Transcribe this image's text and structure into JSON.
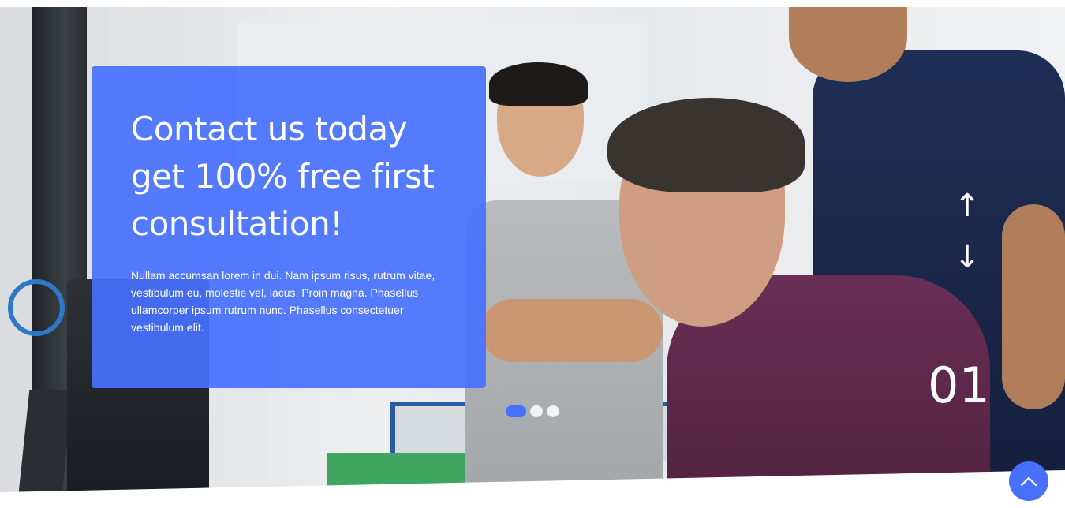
{
  "hero": {
    "title": "Contact us today get 100% free first consultation!",
    "description": "Nullam accumsan lorem in dui. Nam ipsum risus, rutrum vitae, vestibulum eu, molestie vel, lacus. Proin magna. Phasellus ullamcorper ipsum rutrum nunc. Phasellus consectetuer vestibulum elit.",
    "slide_number": "01",
    "active_dot": 1,
    "dot_count": 3
  },
  "nav": {
    "prev_icon": "arrow-up-icon",
    "next_icon": "arrow-down-icon",
    "prev_glyph": "↑",
    "next_glyph": "↓"
  },
  "scroll_top": {
    "icon": "chevron-up-icon"
  },
  "colors": {
    "accent": "#4770ff",
    "text": "#ffffff"
  }
}
